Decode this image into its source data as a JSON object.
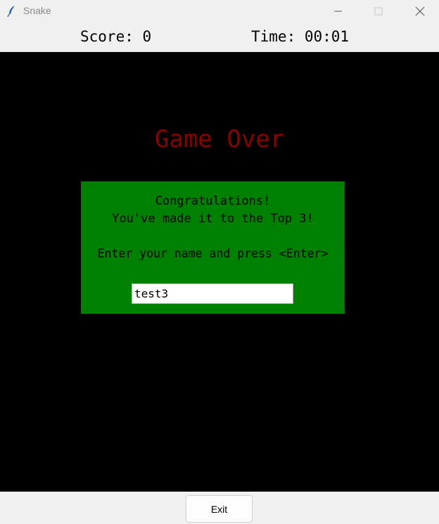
{
  "window": {
    "title": "Snake",
    "icon": "feather-icon",
    "controls": [
      "minimize-icon",
      "maximize-icon",
      "close-icon"
    ]
  },
  "hud": {
    "score_text": "Score: 0",
    "time_text": "Time: 00:01"
  },
  "game": {
    "status": "Game Over",
    "dialog": {
      "line1": "Congratulations!",
      "line2": "You've made it to the Top 3!",
      "prompt": "Enter your name and press <Enter>",
      "name_value": "test3"
    }
  },
  "footer": {
    "exit_label": "Exit"
  },
  "colors": {
    "game_background": "#000000",
    "game_over_text": "#8b0000",
    "dialog_background": "#008000"
  }
}
